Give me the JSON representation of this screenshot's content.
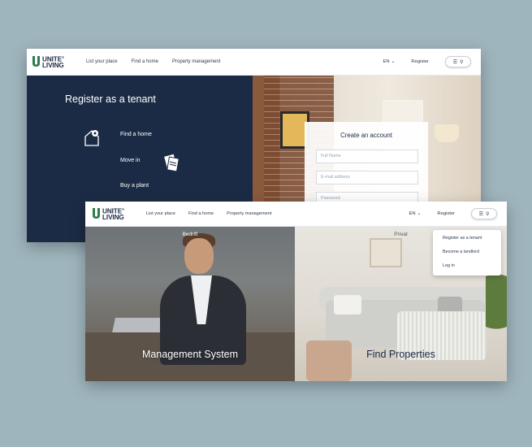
{
  "brand": {
    "line1": "UNITE",
    "line2": "LIVING",
    "reg": "®"
  },
  "nav": {
    "links": [
      "List your place",
      "Find a home",
      "Property management"
    ],
    "lang": "EN",
    "register": "Register"
  },
  "tenant": {
    "title": "Register as a tenant",
    "steps": [
      "Find a home",
      "Move in",
      "Buy a plant"
    ]
  },
  "account_form": {
    "title": "Create an account",
    "full_name_placeholder": "Full Name",
    "email_placeholder": "E-mail address",
    "password_placeholder": "Password"
  },
  "landing": {
    "left_tag": "Bedrift",
    "left_title": "Management System",
    "right_tag": "Privat",
    "right_title": "Find Properties"
  },
  "menu_dropdown": [
    "Register as a tenant",
    "Become a landlord",
    "Log in"
  ],
  "colors": {
    "navy": "#1c2b45",
    "brand_green": "#2e7d4f",
    "background": "#9fb5bd"
  }
}
